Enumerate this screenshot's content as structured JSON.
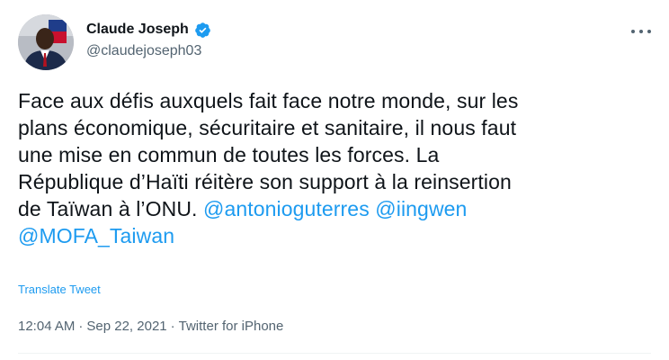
{
  "author": {
    "display_name": "Claude Joseph",
    "handle": "@claudejoseph03",
    "verified": true
  },
  "tweet": {
    "text_lines": [
      "Face aux défis auxquels fait face notre monde, sur les",
      "plans économique, sécuritaire et sanitaire, il nous faut",
      "une mise en commun de toutes les forces. La",
      "République d’Haïti réitère son support à la reinsertion",
      "de Taïwan à l’ONU. "
    ],
    "mentions": [
      "@antonioguterres",
      "@iingwen",
      "@MOFA_Taiwan"
    ],
    "translate_label": "Translate Tweet",
    "time": "12:04 AM",
    "date": "Sep 22, 2021",
    "source": "Twitter for iPhone",
    "separator": "·"
  },
  "icons": {
    "verified": "verified-badge-icon",
    "more": "more-options-icon"
  },
  "colors": {
    "accent": "#1d9bf0",
    "text": "#0f1419",
    "muted": "#536471"
  }
}
